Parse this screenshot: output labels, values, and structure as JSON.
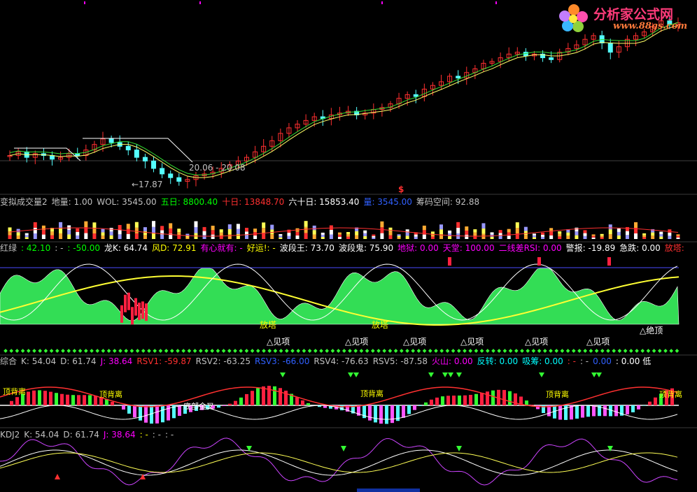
{
  "logo": {
    "title": "分析家公式网",
    "url": "www.88gs.com"
  },
  "price_panel": {
    "high_label": "20.06 - 20.08",
    "low_label": "←17.87",
    "mark": "$"
  },
  "volume_bar": [
    {
      "text": "变拟成交量2",
      "color": "#c0c0c0"
    },
    {
      "text": "地量: 1.00",
      "color": "#c0c0c0"
    },
    {
      "text": "WOL: 3545.00",
      "color": "#c0c0c0"
    },
    {
      "text": "五日: 8800.40",
      "color": "#00ff00"
    },
    {
      "text": "十日: 13848.70",
      "color": "#ff3030"
    },
    {
      "text": "六十日: 15853.40",
      "color": "#ffffff"
    },
    {
      "text": "量: 3545.00",
      "color": "#3060ff"
    },
    {
      "text": "筹码空间: 92.88",
      "color": "#c0c0c0"
    }
  ],
  "indicator_bar": [
    {
      "text": "红绿",
      "color": "#c0c0c0"
    },
    {
      "text": ": 42.10",
      "color": "#00ff00"
    },
    {
      "text": ": -",
      "color": "#c0c0c0"
    },
    {
      "text": ": -50.00",
      "color": "#00ff00"
    },
    {
      "text": "龙K: 64.74",
      "color": "#ffffff"
    },
    {
      "text": "风D: 72.91",
      "color": "#ffff00"
    },
    {
      "text": "有心就有: -",
      "color": "#ff00ff"
    },
    {
      "text": "好运!: -",
      "color": "#ffff00"
    },
    {
      "text": "波段王: 73.70",
      "color": "#ffffff"
    },
    {
      "text": "波段鬼: 75.90",
      "color": "#ffffff"
    },
    {
      "text": "地狱: 0.00",
      "color": "#ff00ff"
    },
    {
      "text": "天堂: 100.00",
      "color": "#ff00ff"
    },
    {
      "text": "二线差RSI: 0.00",
      "color": "#ff00ff"
    },
    {
      "text": "警报: -19.89",
      "color": "#ffffff"
    },
    {
      "text": "急跌: 0.00",
      "color": "#ffffff"
    },
    {
      "text": "放塔:",
      "color": "#ff3030"
    }
  ],
  "indicator_labels": {
    "tower1": "放塔",
    "tower2": "放塔",
    "top": "△见项",
    "peak": "△绝顶"
  },
  "rsv_bar": [
    {
      "text": "综合",
      "color": "#c0c0c0"
    },
    {
      "text": "K: 54.04",
      "color": "#c0c0c0"
    },
    {
      "text": "D: 61.74",
      "color": "#c0c0c0"
    },
    {
      "text": "J: 38.64",
      "color": "#ff00ff"
    },
    {
      "text": "RSV1: -59.87",
      "color": "#ff3030"
    },
    {
      "text": "RSV2: -63.25",
      "color": "#c0c0c0"
    },
    {
      "text": "RSV3: -66.00",
      "color": "#3060ff"
    },
    {
      "text": "RSV4: -76.63",
      "color": "#c0c0c0"
    },
    {
      "text": "RSV5: -87.58",
      "color": "#c0c0c0"
    },
    {
      "text": "火山: 0.00",
      "color": "#ff00ff"
    },
    {
      "text": "反转: 0.00",
      "color": "#00ffff"
    },
    {
      "text": "吸筹: 0.00",
      "color": "#00ffff"
    },
    {
      "text": ": -",
      "color": "#ff3030"
    },
    {
      "text": ": -",
      "color": "#c0c0c0"
    },
    {
      "text": "0.00",
      "color": "#3060ff"
    },
    {
      "text": ": 0.00 低",
      "color": "#ffffff"
    }
  ],
  "rsv_labels": {
    "div": "顶背离",
    "cross": "底部金叉"
  },
  "kdj_bar": [
    {
      "text": "KDJ2",
      "color": "#c0c0c0"
    },
    {
      "text": "K: 54.04",
      "color": "#c0c0c0"
    },
    {
      "text": "D: 61.74",
      "color": "#c0c0c0"
    },
    {
      "text": "J: 38.64",
      "color": "#ff00ff"
    },
    {
      "text": ": -",
      "color": "#ffff00"
    },
    {
      "text": ": -",
      "color": "#c0c0c0"
    },
    {
      "text": ": -",
      "color": "#c0c0c0"
    }
  ],
  "chart_data": {
    "type": "line",
    "close": [
      19.3,
      19.5,
      19.2,
      19.4,
      19.3,
      19.1,
      19.2,
      19.4,
      19.3,
      19.6,
      19.9,
      20.2,
      20.0,
      19.8,
      19.6,
      19.2,
      19.0,
      18.6,
      18.3,
      18.1,
      17.9,
      18.0,
      18.2,
      18.3,
      18.4,
      18.6,
      18.8,
      19.0,
      19.2,
      19.5,
      19.8,
      20.1,
      20.5,
      20.8,
      21.0,
      21.2,
      21.4,
      21.3,
      21.5,
      21.6,
      21.7,
      21.5,
      21.6,
      21.8,
      21.9,
      22.1,
      22.4,
      22.6,
      22.5,
      22.9,
      23.1,
      23.3,
      23.6,
      23.5,
      23.8,
      24.0,
      24.3,
      24.4,
      24.6,
      24.8,
      24.9,
      24.7,
      24.8,
      24.6,
      24.5,
      24.9,
      25.1,
      25.3,
      25.6,
      25.8,
      25.4,
      24.9,
      25.2,
      25.6,
      25.8,
      26.0,
      26.3,
      26.6,
      26.4,
      26.5
    ]
  }
}
